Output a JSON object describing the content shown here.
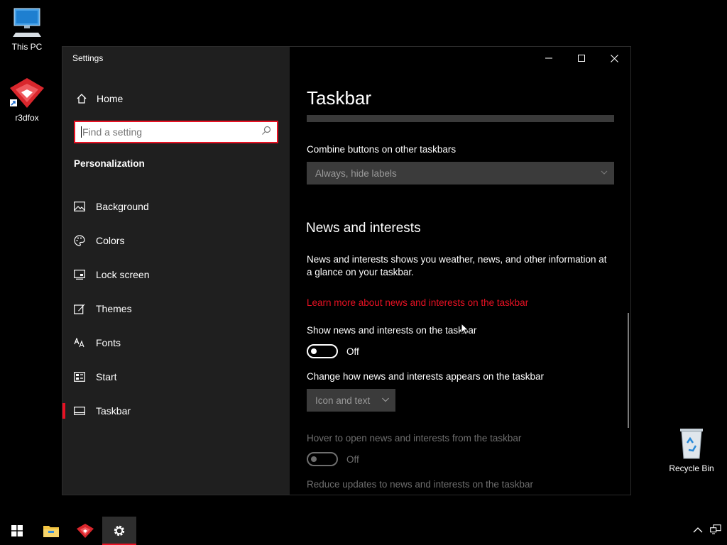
{
  "desktop": {
    "icons": [
      {
        "label": "This PC"
      },
      {
        "label": "r3dfox"
      },
      {
        "label": "Recycle Bin"
      }
    ]
  },
  "window": {
    "title": "Settings",
    "sidebar": {
      "home_label": "Home",
      "search_placeholder": "Find a setting",
      "section_heading": "Personalization",
      "items": [
        {
          "label": "Background",
          "icon": "image-icon"
        },
        {
          "label": "Colors",
          "icon": "palette-icon"
        },
        {
          "label": "Lock screen",
          "icon": "lock-screen-icon"
        },
        {
          "label": "Themes",
          "icon": "themes-icon"
        },
        {
          "label": "Fonts",
          "icon": "fonts-icon"
        },
        {
          "label": "Start",
          "icon": "start-icon"
        },
        {
          "label": "Taskbar",
          "icon": "taskbar-icon",
          "active": true
        }
      ]
    },
    "content": {
      "page_title": "Taskbar",
      "combine_other_label": "Combine buttons on other taskbars",
      "combine_other_value": "Always, hide labels",
      "news_heading": "News and interests",
      "news_description": "News and interests shows you weather, news, and other information at a glance on your taskbar.",
      "news_link": "Learn more about news and interests on the taskbar",
      "show_news_label": "Show news and interests on the taskbar",
      "show_news_state": "Off",
      "change_appearance_label": "Change how news and interests appears on the taskbar",
      "change_appearance_value": "Icon and text",
      "hover_label": "Hover to open news and interests from the taskbar",
      "hover_state": "Off",
      "reduce_updates_label": "Reduce updates to news and interests on the taskbar"
    }
  },
  "colors": {
    "accent": "#e81123",
    "sidebar_bg": "#1f1f1f",
    "content_bg": "#000000"
  }
}
